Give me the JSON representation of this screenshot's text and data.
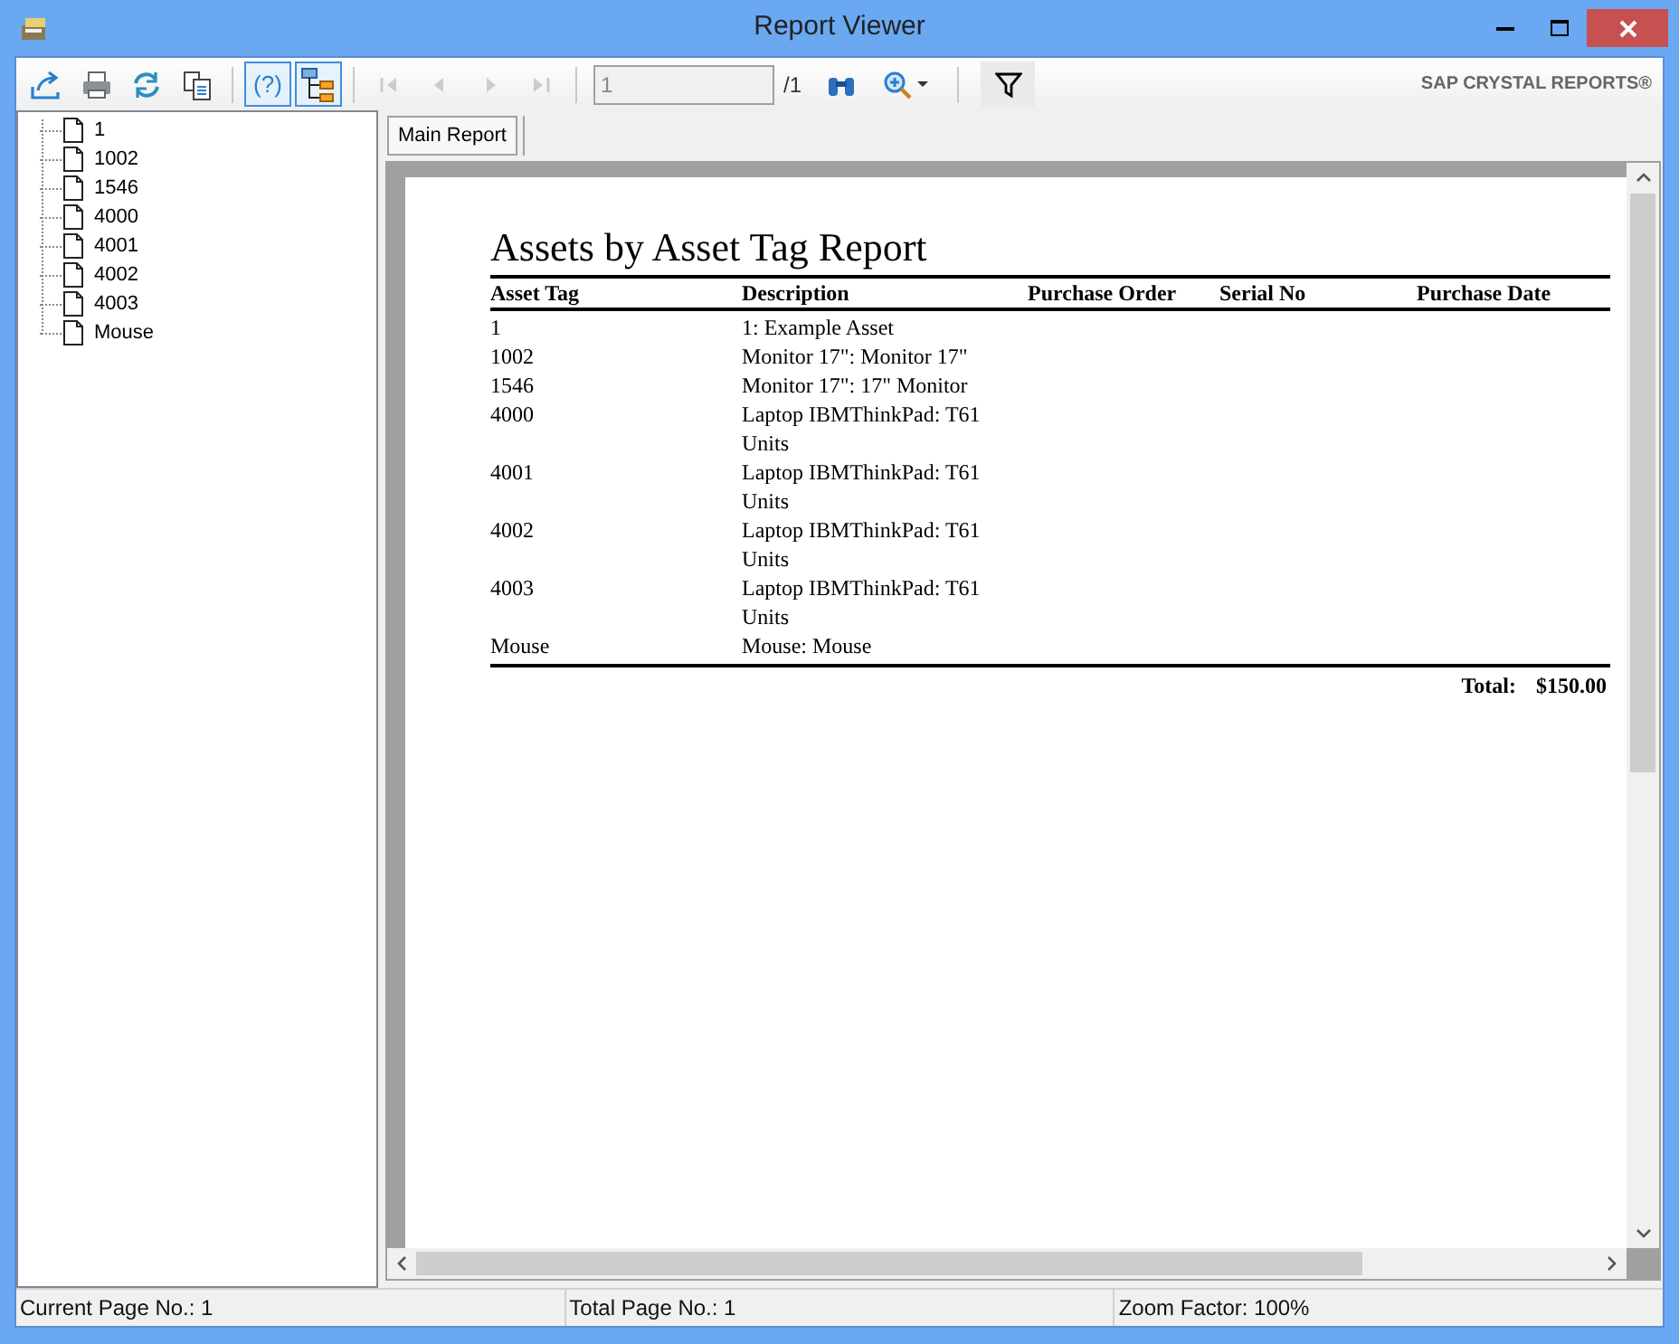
{
  "window": {
    "title": "Report Viewer"
  },
  "toolbar": {
    "buttons": [
      {
        "kind": "export",
        "selected": false,
        "disabled": false
      },
      {
        "kind": "print",
        "selected": false,
        "disabled": false
      },
      {
        "kind": "refresh",
        "selected": false,
        "disabled": false
      },
      {
        "kind": "copy",
        "selected": false,
        "disabled": false
      },
      {
        "kind": "separator"
      },
      {
        "kind": "help",
        "label": "(?)",
        "selected": true,
        "disabled": false
      },
      {
        "kind": "tree",
        "selected": true,
        "disabled": false
      },
      {
        "kind": "separator"
      },
      {
        "kind": "first",
        "disabled": true
      },
      {
        "kind": "prev",
        "disabled": true
      },
      {
        "kind": "next",
        "disabled": true
      },
      {
        "kind": "last",
        "disabled": true
      },
      {
        "kind": "separator"
      }
    ],
    "page_field": {
      "value": "1"
    },
    "page_total": "/1",
    "brand": "SAP CRYSTAL REPORTS®"
  },
  "tree": {
    "items": [
      {
        "label": "1"
      },
      {
        "label": "1002"
      },
      {
        "label": "1546"
      },
      {
        "label": "4000"
      },
      {
        "label": "4001"
      },
      {
        "label": "4002"
      },
      {
        "label": "4003"
      },
      {
        "label": "Mouse"
      }
    ]
  },
  "tabs": [
    {
      "label": "Main Report",
      "selected": true
    }
  ],
  "report": {
    "title": "Assets by Asset Tag Report",
    "columns": [
      "Asset Tag",
      "Description",
      "Purchase Order",
      "Serial No",
      "Purchase Date"
    ],
    "rows": [
      {
        "tag": "1",
        "description": "1: Example Asset"
      },
      {
        "tag": "1002",
        "description": "Monitor 17\": Monitor 17\""
      },
      {
        "tag": "1546",
        "description": "Monitor 17\": 17\" Monitor"
      },
      {
        "tag": "4000",
        "description": "Laptop IBMThinkPad: T61 Units"
      },
      {
        "tag": "4001",
        "description": "Laptop IBMThinkPad: T61 Units"
      },
      {
        "tag": "4002",
        "description": "Laptop IBMThinkPad: T61 Units"
      },
      {
        "tag": "4003",
        "description": "Laptop IBMThinkPad: T61 Units"
      },
      {
        "tag": "Mouse",
        "description": "Mouse: Mouse"
      }
    ],
    "total_label": "Total:",
    "total_value": "$150.00"
  },
  "status_bar": [
    "Current Page No.: 1",
    "Total Page No.: 1",
    "Zoom Factor: 100%"
  ]
}
